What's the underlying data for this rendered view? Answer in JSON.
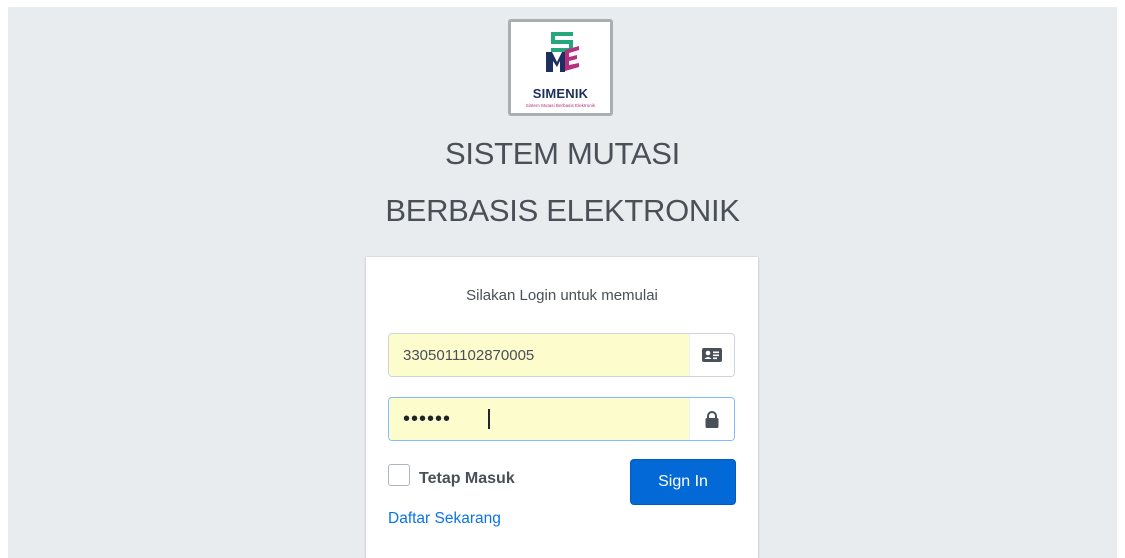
{
  "brand": {
    "logo_word": "SIMENIK",
    "logo_tagline": "Sistem Mutasi Berbasis Elektronik",
    "logo_colors": [
      "#23a77b",
      "#1d2f5e",
      "#b5307e"
    ]
  },
  "header": {
    "title_line1": "SISTEM MUTASI",
    "title_line2": "BERBASIS ELEKTRONIK"
  },
  "login": {
    "message": "Silakan Login untuk memulai",
    "username_value": "3305011102870005",
    "username_icon": "id-card-icon",
    "password_display": "••••••",
    "password_icon": "lock-icon",
    "remember_label": "Tetap Masuk",
    "remember_checked": false,
    "signin_label": "Sign In",
    "register_link": "Daftar Sekarang"
  },
  "colors": {
    "background": "#e9ecef",
    "primary": "#0369d6",
    "autofill": "#fdfccc",
    "text": "#495057"
  }
}
